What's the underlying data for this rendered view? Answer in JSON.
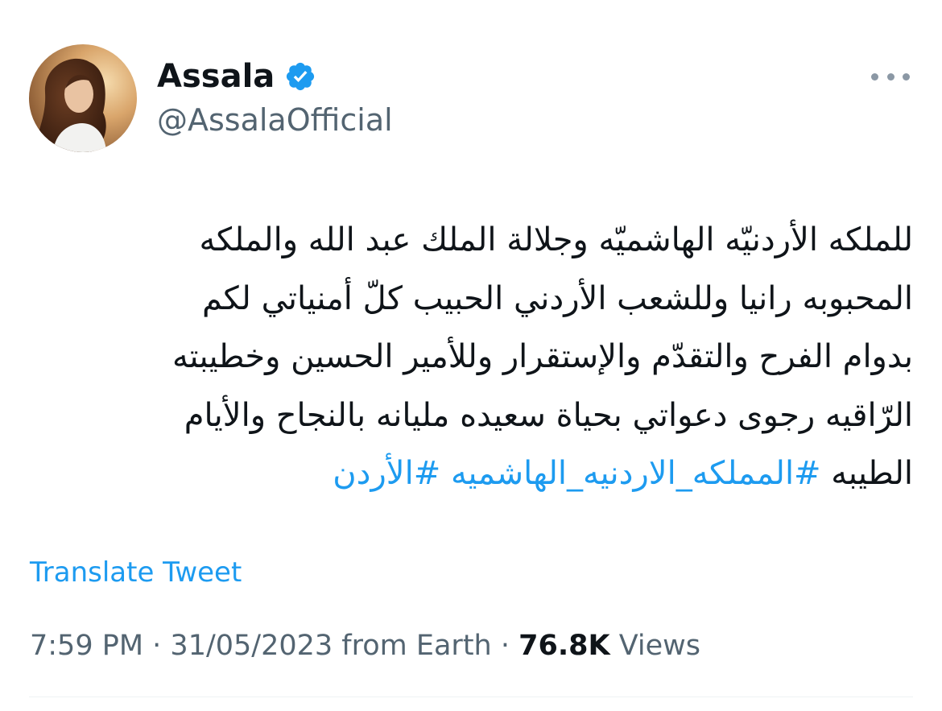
{
  "user": {
    "display_name": "Assala",
    "handle": "@AssalaOfficial",
    "verified": true,
    "avatar_icon": "profile-photo"
  },
  "tweet": {
    "text_lines": [
      "للملكه الأردنيّه الهاشميّه وجلالة الملك عبد الله والملكه",
      "المحبوبه رانيا وللشعب الأردني الحبيب كلّ أمنياتي لكم",
      "بدوام الفرح والتقدّم والإستقرار وللأمير الحسين وخطيبته",
      "الرّاقيه رجوى دعواتي بحياة سعيده مليانه بالنجاح والأيام"
    ],
    "last_line_text": "الطيبه",
    "hashtags": [
      "#المملكه_الاردنيه_الهاشميه",
      "#الأردن"
    ]
  },
  "translate_label": "Translate Tweet",
  "meta": {
    "time": "7:59 PM",
    "separator": " · ",
    "date": "31/05/2023",
    "source": "from Earth",
    "views_count": "76.8K",
    "views_label": "Views"
  },
  "colors": {
    "accent": "#1d9bf0",
    "text_primary": "#0f1419",
    "text_secondary": "#536471"
  },
  "icons": {
    "verified": "verified-badge-icon",
    "more": "more-options-icon"
  }
}
